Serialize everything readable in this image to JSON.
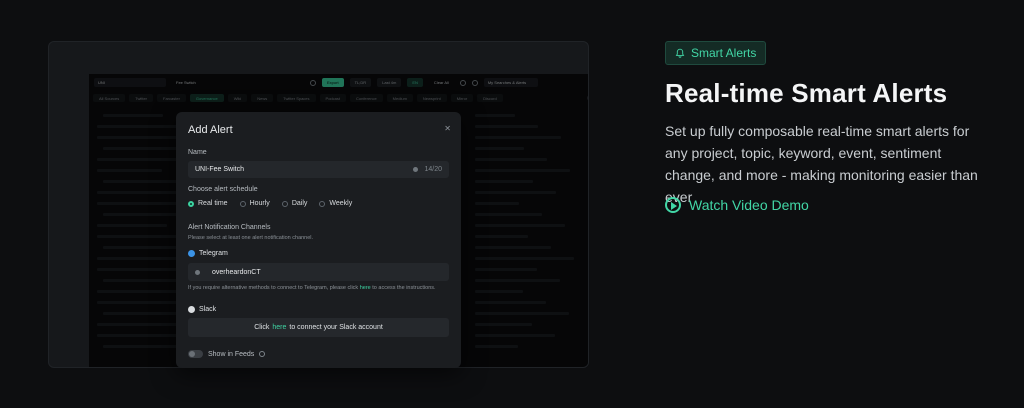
{
  "app": {
    "topbar": {
      "token": "UNI",
      "search_value": "Fee Switch",
      "export_label": "Export",
      "tldr_label": "TL;DR",
      "range_label": "Last 4m",
      "lang_label": "EN",
      "clear_label": "Clear All",
      "saved_label": "My Searches & Alerts"
    },
    "tabs": [
      "All Sources",
      "Twitter",
      "Farcaster",
      "Governance",
      "Wiki",
      "News",
      "Twitter Spaces",
      "Podcast",
      "Conference",
      "Medium",
      "Newsprint",
      "Mirror",
      "Discord"
    ]
  },
  "modal": {
    "title": "Add Alert",
    "name_label": "Name",
    "name_value": "UNI-Fee Switch",
    "name_count": "14/20",
    "schedule_label": "Choose alert schedule",
    "schedule_options": [
      "Real time",
      "Hourly",
      "Daily",
      "Weekly"
    ],
    "channels_label": "Alert Notification Channels",
    "channels_hint": "Please select at least one alert notification channel.",
    "telegram_label": "Telegram",
    "telegram_value": "overheardonCT",
    "telegram_help_prefix": "If you require alternative methods to connect to Telegram, please click",
    "telegram_help_link": "here",
    "telegram_help_suffix": "to access the instructions.",
    "slack_label": "Slack",
    "slack_prefix": "Click",
    "slack_link": "here",
    "slack_suffix": "to connect your Slack account",
    "show_in_feeds_label": "Show in Feeds"
  },
  "promo": {
    "badge": "Smart Alerts",
    "headline": "Real-time Smart Alerts",
    "description": "Set up fully composable real-time smart alerts for any project, topic, keyword, event, sentiment change, and more - making monitoring easier than ever",
    "cta": "Watch Video Demo"
  },
  "colors": {
    "accent": "#42d6a6",
    "background": "#0d0e10"
  }
}
